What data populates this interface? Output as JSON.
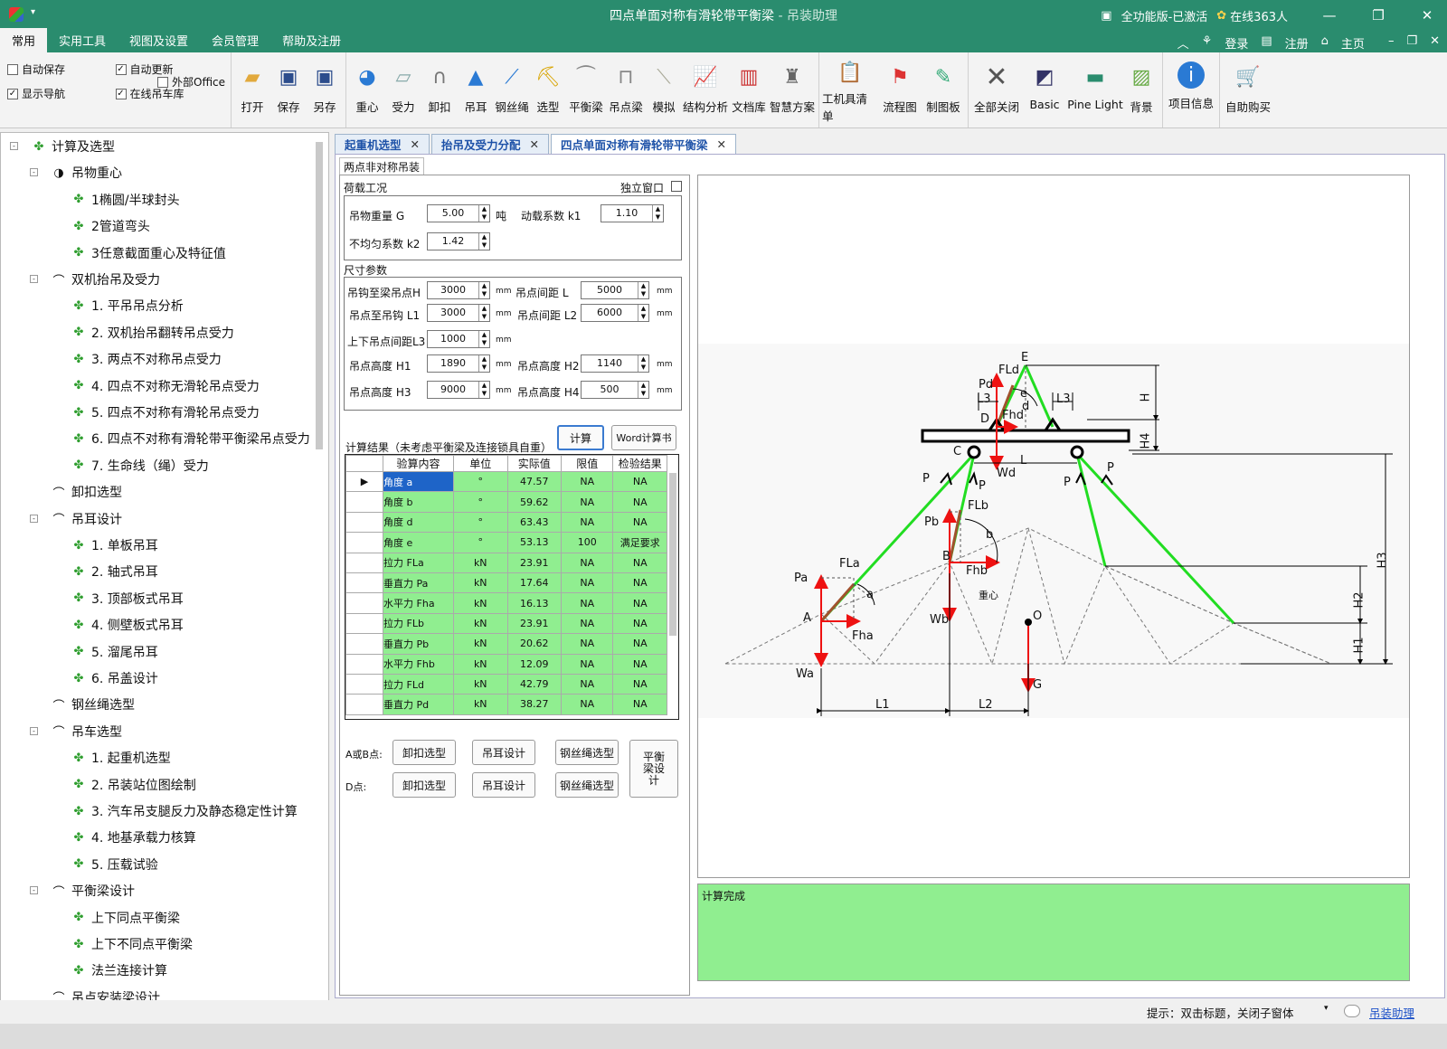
{
  "app": {
    "title": "四点单面对称有滑轮带平衡梁",
    "title_sub": " - 吊装助理",
    "edition": "全功能版-已激活",
    "online": "在线363人",
    "minimize": "—",
    "maximize": "❐",
    "close": "✕"
  },
  "menu": {
    "items": [
      "常用",
      "实用工具",
      "视图及设置",
      "会员管理",
      "帮助及注册"
    ],
    "right": [
      "登录",
      "注册",
      "主页"
    ]
  },
  "options": {
    "autosave": "自动保存",
    "autoupdate": "自动更新",
    "show_nav": "显示导航",
    "online_lib": "在线吊车库",
    "external_office": "外部Office"
  },
  "ribbon": {
    "file": [
      "打开",
      "保存",
      "另存"
    ],
    "tools": [
      "重心",
      "受力",
      "卸扣",
      "吊耳",
      "钢丝绳",
      "选型",
      "平衡梁",
      "吊点梁",
      "模拟",
      "结构分析",
      "文档库",
      "智慧方案"
    ],
    "misc": [
      "工机具清单",
      "流程图",
      "制图板"
    ],
    "view": [
      "全部关闭",
      "Basic",
      "Pine Light",
      "背景"
    ],
    "info": [
      "项目信息"
    ],
    "buy": [
      "自助购买"
    ]
  },
  "tree": [
    {
      "label": "计算及选型",
      "level": 0,
      "icon": "leaf-icon",
      "exp": "-"
    },
    {
      "label": "吊物重心",
      "level": 1,
      "icon": "center-of-gravity-icon",
      "exp": "-"
    },
    {
      "label": "1椭圆/半球封头",
      "level": 2,
      "icon": "leaf-icon"
    },
    {
      "label": "2管道弯头",
      "level": 2,
      "icon": "leaf-icon"
    },
    {
      "label": "3任意截面重心及特征值",
      "level": 2,
      "icon": "leaf-icon"
    },
    {
      "label": "双机抬吊及受力",
      "level": 1,
      "icon": "beam-icon",
      "exp": "-"
    },
    {
      "label": "1. 平吊吊点分析",
      "level": 2,
      "icon": "leaf-icon"
    },
    {
      "label": "2. 双机抬吊翻转吊点受力",
      "level": 2,
      "icon": "leaf-icon"
    },
    {
      "label": "3. 两点不对称吊点受力",
      "level": 2,
      "icon": "leaf-icon"
    },
    {
      "label": "4. 四点不对称无滑轮吊点受力",
      "level": 2,
      "icon": "leaf-icon"
    },
    {
      "label": "5. 四点不对称有滑轮吊点受力",
      "level": 2,
      "icon": "leaf-icon"
    },
    {
      "label": "6. 四点不对称有滑轮带平衡梁吊点受力",
      "level": 2,
      "icon": "leaf-icon"
    },
    {
      "label": "7. 生命线（绳）受力",
      "level": 2,
      "icon": "leaf-icon"
    },
    {
      "label": "卸扣选型",
      "level": 1,
      "icon": "shackle-icon"
    },
    {
      "label": "吊耳设计",
      "level": 1,
      "icon": "lug-icon",
      "exp": "-"
    },
    {
      "label": "1. 单板吊耳",
      "level": 2,
      "icon": "leaf-icon"
    },
    {
      "label": "2. 轴式吊耳",
      "level": 2,
      "icon": "leaf-icon"
    },
    {
      "label": "3. 顶部板式吊耳",
      "level": 2,
      "icon": "leaf-icon"
    },
    {
      "label": "4. 侧壁板式吊耳",
      "level": 2,
      "icon": "leaf-icon"
    },
    {
      "label": "5. 溜尾吊耳",
      "level": 2,
      "icon": "leaf-icon"
    },
    {
      "label": "6. 吊盖设计",
      "level": 2,
      "icon": "leaf-icon"
    },
    {
      "label": "钢丝绳选型",
      "level": 1,
      "icon": "wire-rope-icon"
    },
    {
      "label": "吊车选型",
      "level": 1,
      "icon": "crane-icon",
      "exp": "-"
    },
    {
      "label": "1. 起重机选型",
      "level": 2,
      "icon": "leaf-icon"
    },
    {
      "label": "2. 吊装站位图绘制",
      "level": 2,
      "icon": "leaf-icon"
    },
    {
      "label": "3. 汽车吊支腿反力及静态稳定性计算",
      "level": 2,
      "icon": "leaf-icon"
    },
    {
      "label": "4. 地基承载力核算",
      "level": 2,
      "icon": "leaf-icon"
    },
    {
      "label": "5. 压载试验",
      "level": 2,
      "icon": "leaf-icon"
    },
    {
      "label": "平衡梁设计",
      "level": 1,
      "icon": "balance-beam-icon",
      "exp": "-"
    },
    {
      "label": "上下同点平衡梁",
      "level": 2,
      "icon": "leaf-icon"
    },
    {
      "label": "上下不同点平衡梁",
      "level": 2,
      "icon": "leaf-icon"
    },
    {
      "label": "法兰连接计算",
      "level": 2,
      "icon": "leaf-icon"
    },
    {
      "label": "吊点安装梁设计",
      "level": 1,
      "icon": "beam-icon"
    }
  ],
  "tabs": [
    "起重机选型",
    "抬吊及受力分配",
    "四点单面对称有滑轮带平衡梁"
  ],
  "subtab": "两点非对称吊装",
  "load": {
    "title": "荷载工况",
    "independent": "独立窗口",
    "weight_label": "吊物重量 G",
    "weight": "5.00",
    "weight_unit": "吨",
    "dyn_label": "动载系数 k1",
    "dyn": "1.10",
    "uneven_label": "不均匀系数 k2",
    "uneven": "1.42"
  },
  "dims": {
    "title": "尺寸参数",
    "unit": "mm",
    "H_label": "吊钩至梁吊点H",
    "H": "3000",
    "L_label": "吊点间距 L",
    "L": "5000",
    "L1_label": "吊点至吊钩 L1",
    "L1": "3000",
    "L2_label": "吊点间距 L2",
    "L2": "6000",
    "L3_label": "上下吊点间距L3",
    "L3": "1000",
    "H1_label": "吊点高度 H1",
    "H1": "1890",
    "H2_label": "吊点高度 H2",
    "H2": "1140",
    "H3_label": "吊点高度 H3",
    "H3": "9000",
    "H4_label": "吊点高度 H4",
    "H4": "500"
  },
  "results": {
    "title": "计算结果（未考虑平衡梁及连接锁具自重）",
    "calc_btn": "计算",
    "word_btn": "Word计算书",
    "headers": [
      "验算内容",
      "单位",
      "实际值",
      "限值",
      "检验结果"
    ],
    "rows": [
      [
        "角度 a",
        "°",
        "47.57",
        "NA",
        "NA"
      ],
      [
        "角度 b",
        "°",
        "59.62",
        "NA",
        "NA"
      ],
      [
        "角度 d",
        "°",
        "63.43",
        "NA",
        "NA"
      ],
      [
        "角度 e",
        "°",
        "53.13",
        "100",
        "满足要求"
      ],
      [
        "拉力 FLa",
        "kN",
        "23.91",
        "NA",
        "NA"
      ],
      [
        "垂直力 Pa",
        "kN",
        "17.64",
        "NA",
        "NA"
      ],
      [
        "水平力 Fha",
        "kN",
        "16.13",
        "NA",
        "NA"
      ],
      [
        "拉力 FLb",
        "kN",
        "23.91",
        "NA",
        "NA"
      ],
      [
        "垂直力 Pb",
        "kN",
        "20.62",
        "NA",
        "NA"
      ],
      [
        "水平力 Fhb",
        "kN",
        "12.09",
        "NA",
        "NA"
      ],
      [
        "拉力 FLd",
        "kN",
        "42.79",
        "NA",
        "NA"
      ],
      [
        "垂直力 Pd",
        "kN",
        "38.27",
        "NA",
        "NA"
      ]
    ],
    "row_marker": "▶"
  },
  "actions": {
    "ab_label": "A或B点:",
    "d_label": "D点:",
    "shackle": "卸扣选型",
    "lug": "吊耳设计",
    "rope": "钢丝绳选型",
    "beam_design": "平衡梁设计"
  },
  "diagram_labels": {
    "E": "E",
    "FLd": "FLd",
    "Pd": "Pd",
    "L3a": "L3",
    "L3b": "L3",
    "e": "e",
    "d": "d",
    "D": "D",
    "Fhd": "Fhd",
    "H": "H",
    "H4": "H4",
    "C": "C",
    "L": "L",
    "Wd": "Wd",
    "P1": "P",
    "P2": "P",
    "P3": "P",
    "P4": "P",
    "FLb": "FLb",
    "Pb": "Pb",
    "b": "b",
    "B": "B",
    "Fhb": "Fhb",
    "H3": "H3",
    "FLa": "FLa",
    "Pa": "Pa",
    "a": "a",
    "cog": "重心",
    "O": "O",
    "H2": "H2",
    "A": "A",
    "Wb": "Wb",
    "Fha": "Fha",
    "H1": "H1",
    "Wa": "Wa",
    "G": "G",
    "L1": "L1",
    "L2": "L2"
  },
  "status_text": "计算完成",
  "statusbar": {
    "hint": "提示：双击标题，关闭子窗体",
    "link": "吊装助理"
  },
  "colors": {
    "titlebar": "#2a8c6e",
    "rope": "#22dd22",
    "force": "#ee1111",
    "result_cell": "#90ee90",
    "selected": "#1e64c8"
  }
}
